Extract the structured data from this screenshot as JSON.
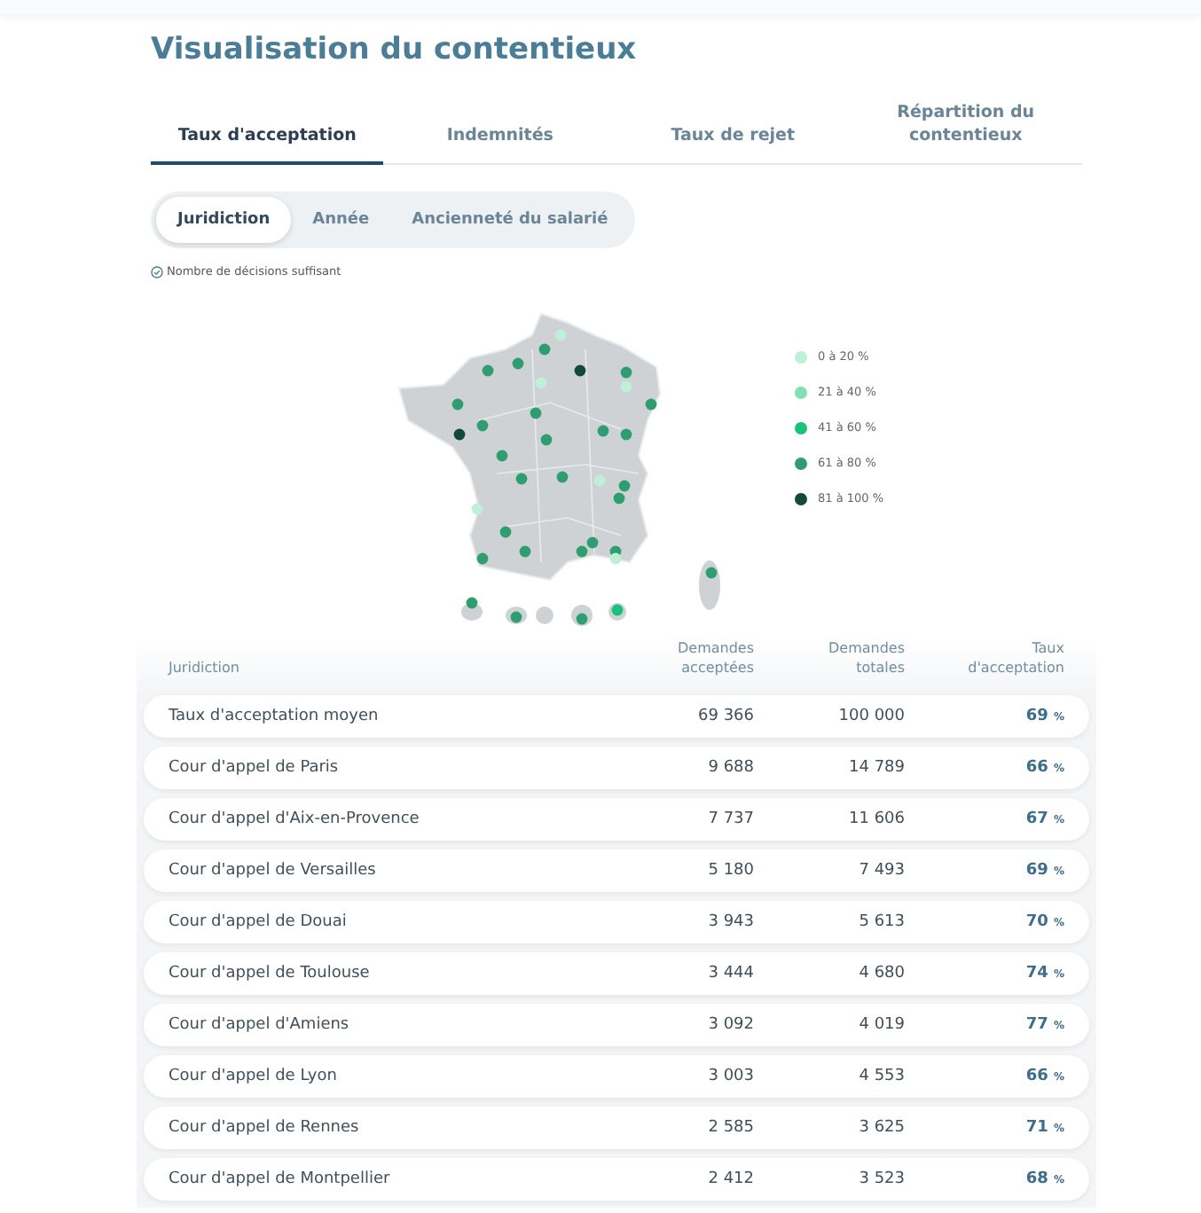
{
  "page": {
    "title": "Visualisation du contentieux"
  },
  "tabs": [
    {
      "label": "Taux d'acceptation",
      "selected": true
    },
    {
      "label": "Indemnités",
      "selected": false
    },
    {
      "label": "Taux de rejet",
      "selected": false
    },
    {
      "label": "Répartition du contentieux",
      "selected": false
    }
  ],
  "segments": [
    {
      "label": "Juridiction",
      "selected": true
    },
    {
      "label": "Année",
      "selected": false
    },
    {
      "label": "Ancienneté du salarié",
      "selected": false
    }
  ],
  "note": "Nombre de décisions suffisant",
  "legend": [
    {
      "label": "0 à 20 %",
      "color": "#bdf0d6"
    },
    {
      "label": "21 à 40 %",
      "color": "#7fe0b2"
    },
    {
      "label": "41 à 60 %",
      "color": "#19c27a"
    },
    {
      "label": "61 à 80 %",
      "color": "#2e9e70"
    },
    {
      "label": "81 à 100 %",
      "color": "#124a38"
    }
  ],
  "table": {
    "columns": [
      "Juridiction",
      "Demandes acceptées",
      "Demandes totales",
      "Taux d'acceptation"
    ],
    "rows": [
      {
        "name": "Taux d'acceptation moyen",
        "accepted": "69 366",
        "total": "100 000",
        "rate": "69",
        "unit": "%"
      },
      {
        "name": "Cour d'appel de Paris",
        "accepted": "9 688",
        "total": "14 789",
        "rate": "66",
        "unit": "%"
      },
      {
        "name": "Cour d'appel d'Aix-en-Provence",
        "accepted": "7 737",
        "total": "11 606",
        "rate": "67",
        "unit": "%"
      },
      {
        "name": "Cour d'appel de Versailles",
        "accepted": "5 180",
        "total": "7 493",
        "rate": "69",
        "unit": "%"
      },
      {
        "name": "Cour d'appel de Douai",
        "accepted": "3 943",
        "total": "5 613",
        "rate": "70",
        "unit": "%"
      },
      {
        "name": "Cour d'appel de Toulouse",
        "accepted": "3 444",
        "total": "4 680",
        "rate": "74",
        "unit": "%"
      },
      {
        "name": "Cour d'appel d'Amiens",
        "accepted": "3 092",
        "total": "4 019",
        "rate": "77",
        "unit": "%"
      },
      {
        "name": "Cour d'appel de Lyon",
        "accepted": "3 003",
        "total": "4 553",
        "rate": "66",
        "unit": "%"
      },
      {
        "name": "Cour d'appel de Rennes",
        "accepted": "2 585",
        "total": "3 625",
        "rate": "71",
        "unit": "%"
      },
      {
        "name": "Cour d'appel de Montpellier",
        "accepted": "2 412",
        "total": "3 523",
        "rate": "68",
        "unit": "%"
      }
    ]
  }
}
